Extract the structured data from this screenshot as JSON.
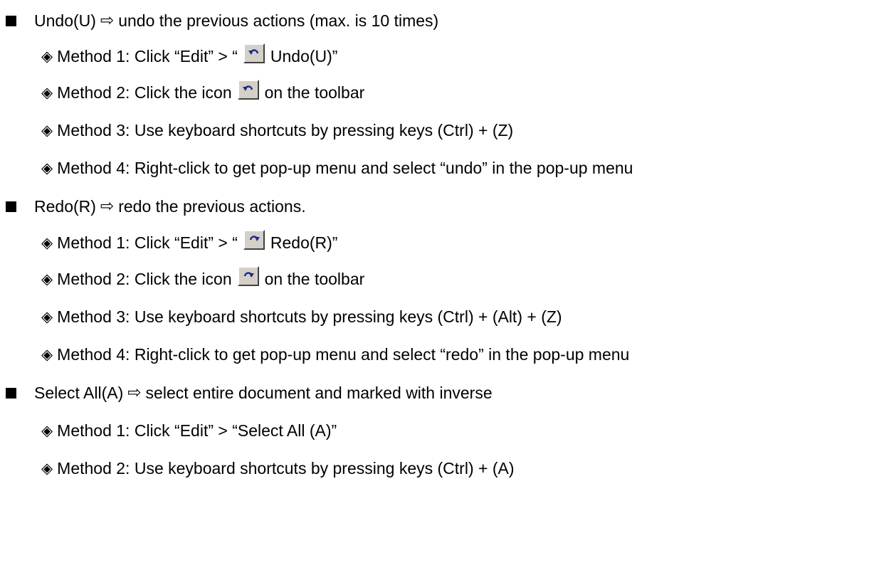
{
  "sections": [
    {
      "title": "Undo(U)",
      "arrow": "⇨",
      "description": "undo the previous actions (max. is 10 times)",
      "methods": [
        {
          "before": "Method 1: Click “Edit” > “",
          "icon": "undo-icon",
          "after": " Undo(U)”"
        },
        {
          "before": "Method 2: Click the icon ",
          "icon": "undo-icon",
          "after": " on the toolbar"
        },
        {
          "before": "Method 3: Use keyboard shortcuts by pressing keys (Ctrl) + (Z)"
        },
        {
          "before": "Method 4: Right-click to get pop-up menu and select “undo” in the pop-up menu"
        }
      ]
    },
    {
      "title": "Redo(R)",
      "arrow": "⇨",
      "description": "redo the previous actions.",
      "methods": [
        {
          "before": "Method 1: Click “Edit” > “",
          "icon": "redo-icon",
          "after": " Redo(R)”"
        },
        {
          "before": "Method 2: Click the icon ",
          "icon": "redo-icon",
          "after": " on the toolbar"
        },
        {
          "before": "Method 3: Use keyboard shortcuts by pressing keys (Ctrl) + (Alt) + (Z)"
        },
        {
          "before": "Method 4: Right-click to get pop-up menu and select “redo” in the pop-up menu"
        }
      ]
    },
    {
      "title": "Select All(A)",
      "arrow": "⇨",
      "description": "select entire document and marked with inverse",
      "methods": [
        {
          "before": "Method 1: Click “Edit” > “Select All (A)”"
        },
        {
          "before": "Method 2: Use keyboard shortcuts by pressing keys (Ctrl) + (A)"
        }
      ]
    }
  ],
  "diamond_glyph": "◈",
  "colors": {
    "text": "#000000",
    "icon_face": "#d4d0c8",
    "icon_arrow": "#1a2a8c"
  }
}
